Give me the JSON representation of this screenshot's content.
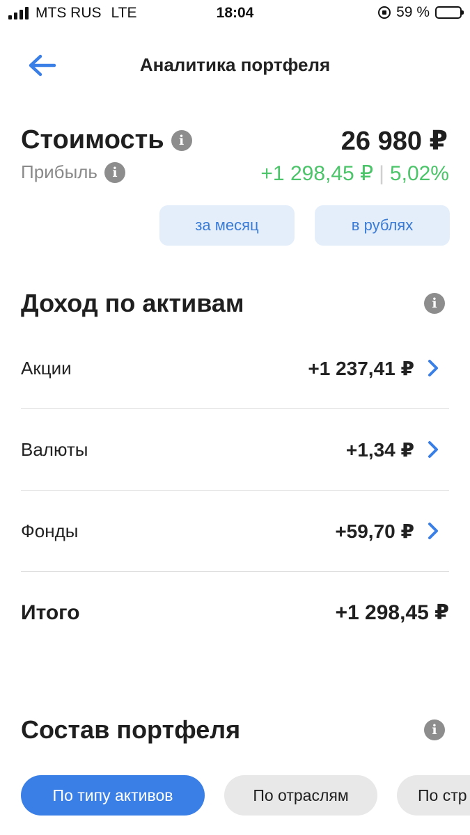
{
  "status_bar": {
    "carrier": "MTS RUS",
    "network": "LTE",
    "time": "18:04",
    "battery_percent": "59 %",
    "battery_level": 0.59
  },
  "nav": {
    "title": "Аналитика портфеля"
  },
  "summary": {
    "value_label": "Стоимость",
    "value_amount": "26 980 ₽",
    "profit_label": "Прибыль",
    "profit_amount": "+1 298,45 ₽",
    "profit_separator": "|",
    "profit_percent": "5,02%"
  },
  "filters": {
    "period": "за месяц",
    "currency": "в рублях"
  },
  "income": {
    "title": "Доход по активам",
    "rows": [
      {
        "name": "Акции",
        "amount": "+1 237,41 ₽"
      },
      {
        "name": "Валюты",
        "amount": "+1,34 ₽"
      },
      {
        "name": "Фонды",
        "amount": "+59,70 ₽"
      }
    ],
    "total_label": "Итого",
    "total_amount": "+1 298,45 ₽"
  },
  "composition": {
    "title": "Состав портфеля",
    "tabs": [
      {
        "label": "По типу активов"
      },
      {
        "label": "По отраслям"
      },
      {
        "label": "По стр"
      }
    ]
  },
  "colors": {
    "accent": "#3a7fe6",
    "profit": "#4cc46a",
    "chip_bg": "#e4eefb"
  }
}
